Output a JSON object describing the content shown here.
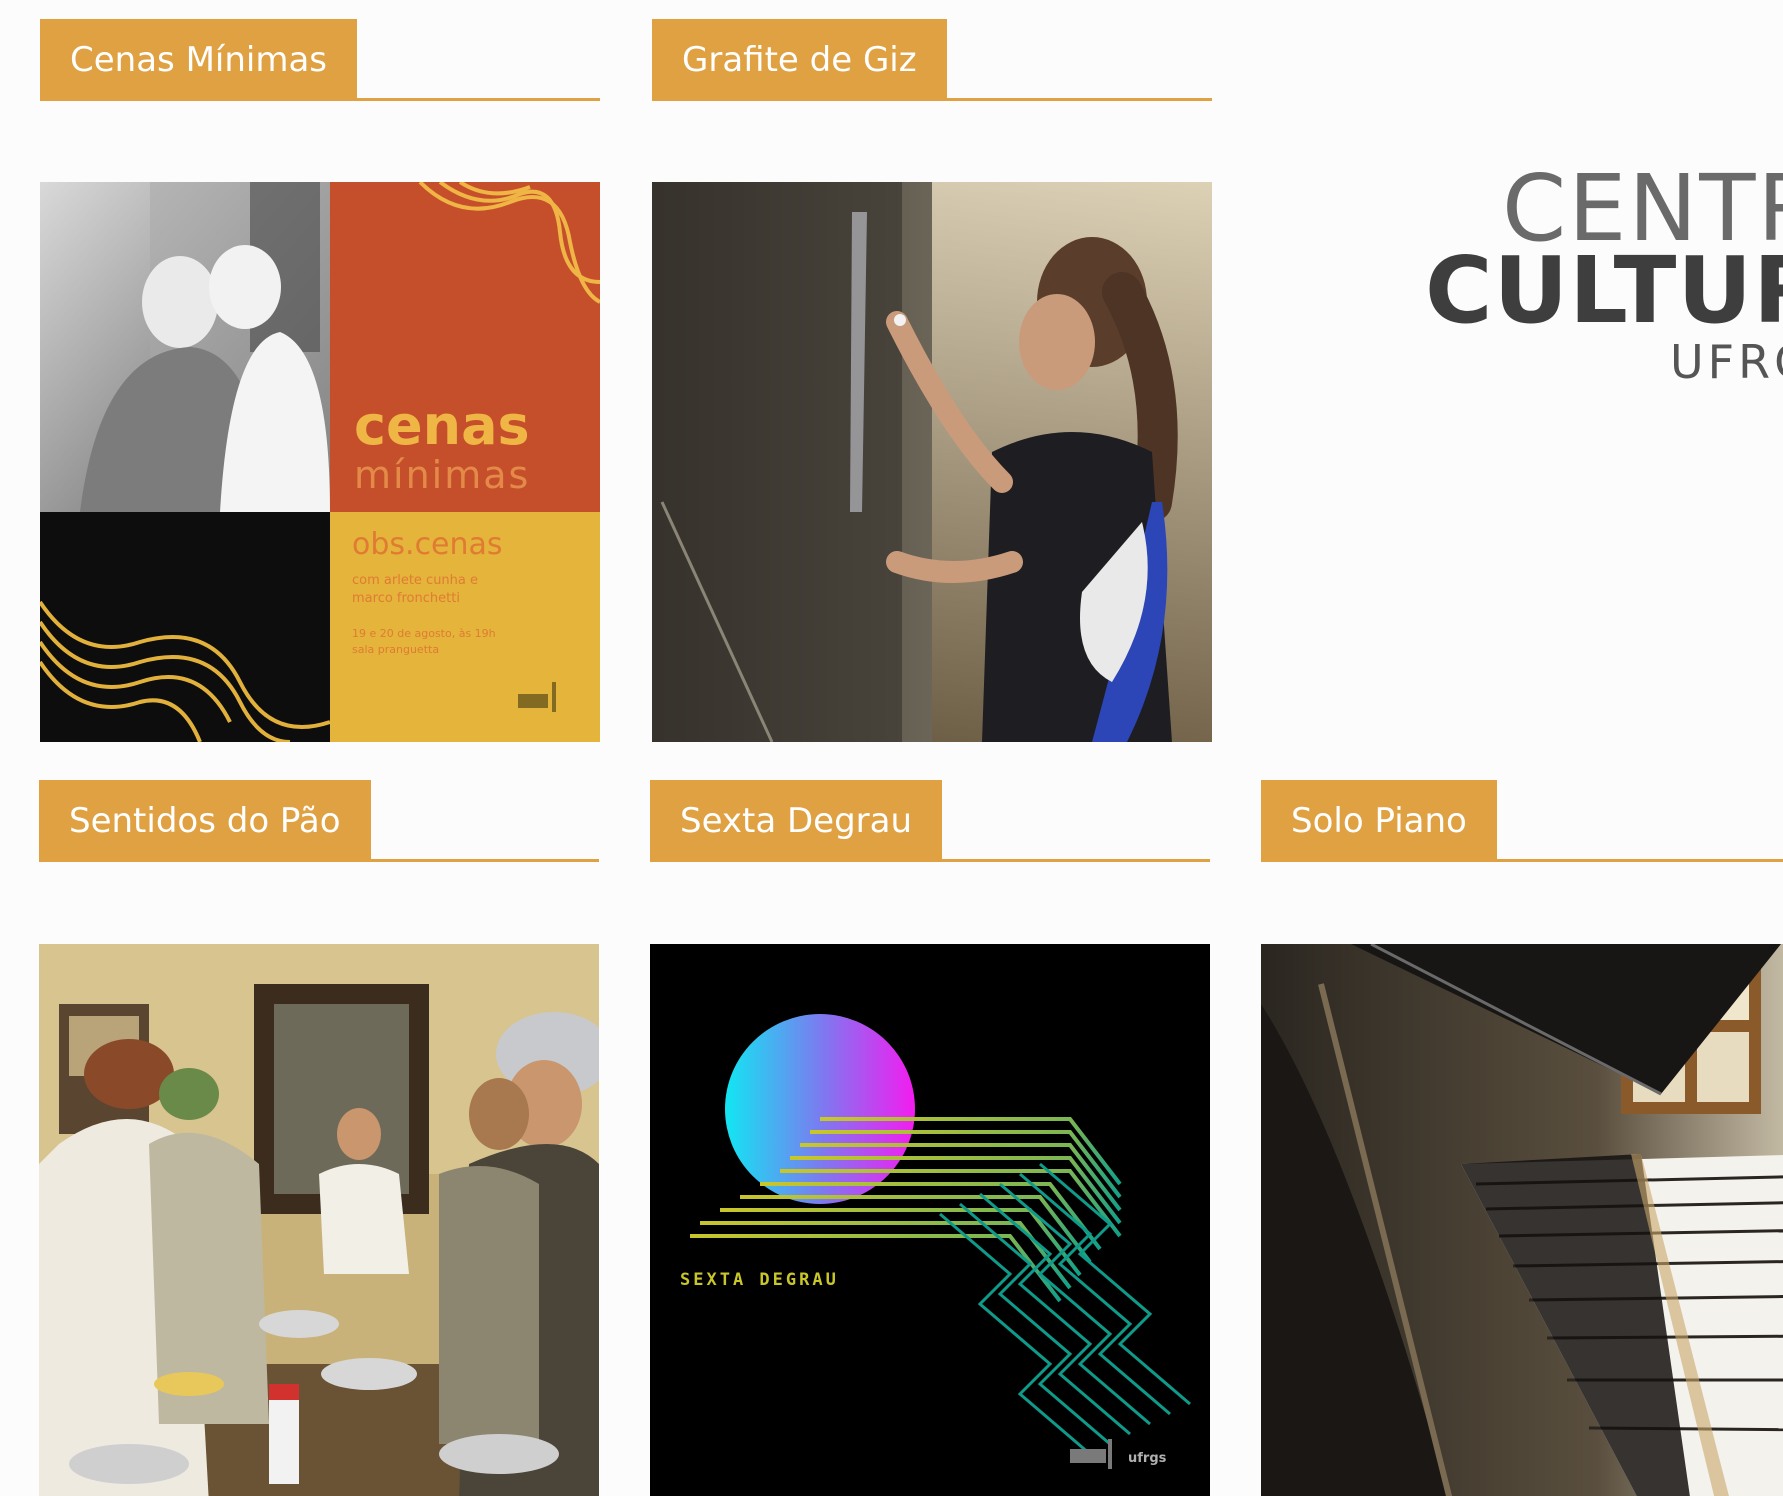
{
  "cards": [
    {
      "title": "Cenas Mínimas",
      "art": {
        "heading": "cenas",
        "subheading": "mínimas",
        "line_1": "obs.cenas",
        "line_2": "com arlete cunha e",
        "line_3": "marco fronchetti",
        "line_4": "19 e 20 de agosto, às 19h",
        "line_5": "sala pranguetta"
      }
    },
    {
      "title": "Grafite de Giz"
    },
    {
      "title": "Sentidos do Pão"
    },
    {
      "title": "Sexta Degrau",
      "art": {
        "caption": "SEXTA DEGRAU",
        "footer_mark": "ufrgs"
      }
    },
    {
      "title": "Solo Piano"
    }
  ],
  "logo": {
    "line_1": "CENTRO",
    "line_2": "CULTURAL",
    "line_3": "UFRGS"
  },
  "colors": {
    "accent": "#e0a143",
    "tab_text": "#ffffff",
    "poster_orange": "#c64f2b",
    "poster_yellow": "#e5b43a"
  }
}
